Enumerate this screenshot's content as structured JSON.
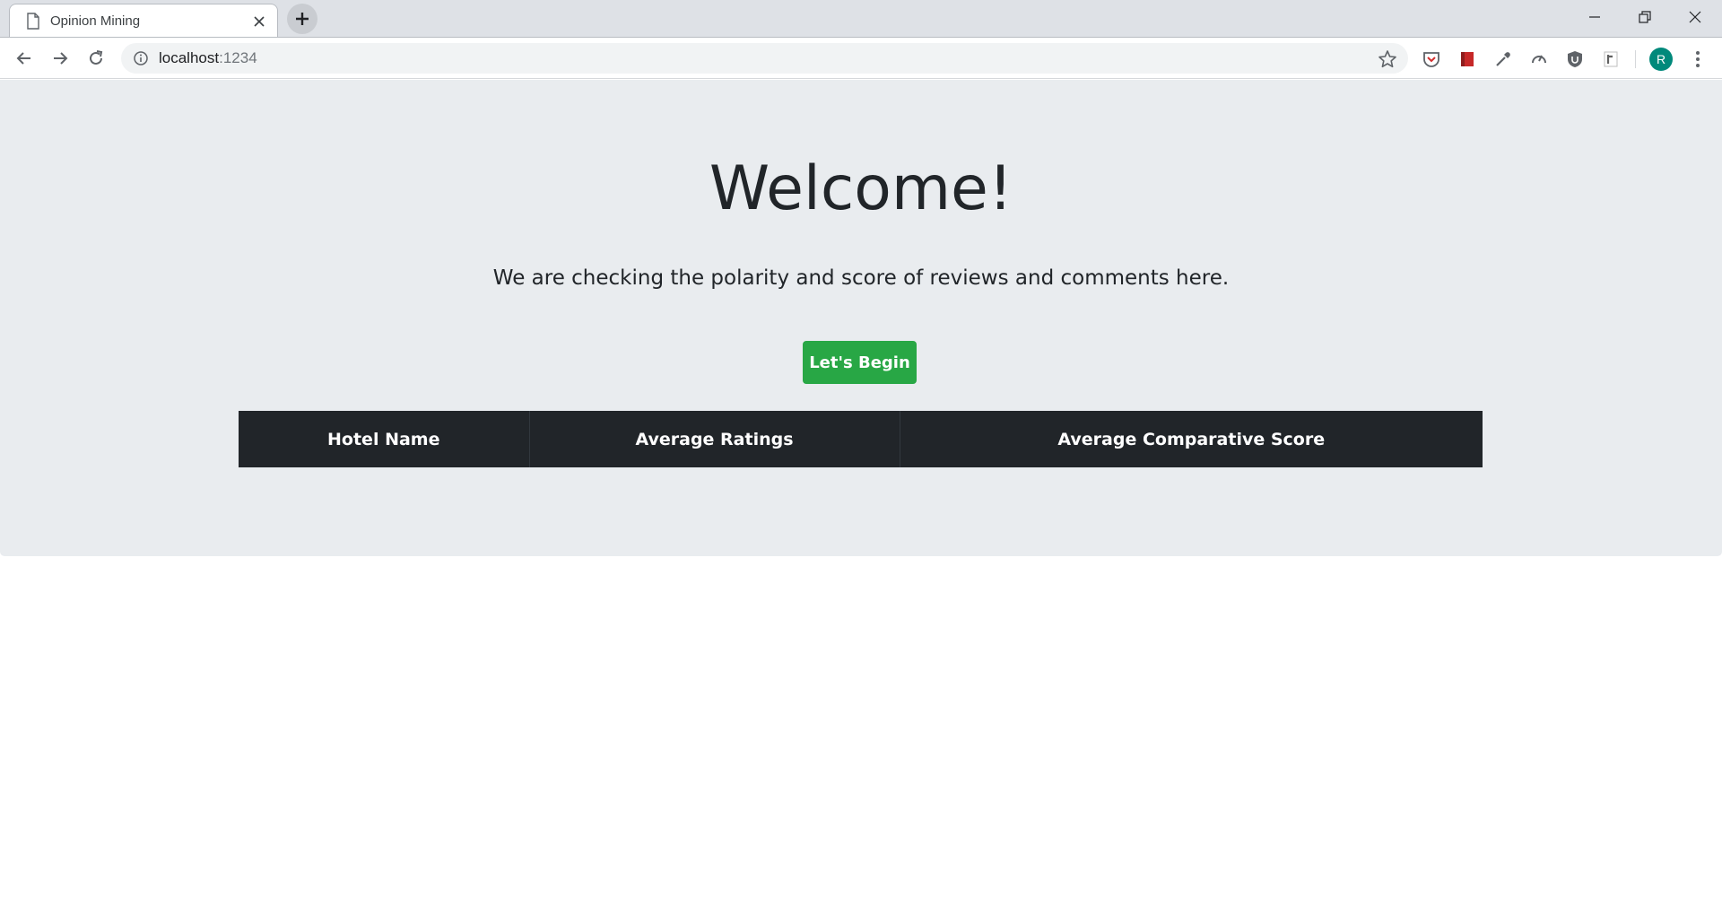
{
  "browser": {
    "tab_title": "Opinion Mining",
    "url_host": "localhost",
    "url_port": ":1234",
    "profile_initial": "R",
    "extensions": [
      "pocket-icon",
      "bookmark-red-icon",
      "eyedropper-icon",
      "speedometer-icon",
      "ublock-shield-icon",
      "readability-icon"
    ]
  },
  "page": {
    "title": "Welcome!",
    "lead": "We are checking the polarity and score of reviews and comments here.",
    "begin_button": "Let's Begin",
    "table": {
      "headers": [
        "Hotel Name",
        "Average Ratings",
        "Average Comparative Score"
      ]
    }
  },
  "colors": {
    "jumbotron_bg": "#e9ecef",
    "button_green": "#28a745",
    "table_dark": "#212529",
    "avatar_teal": "#00897b"
  }
}
